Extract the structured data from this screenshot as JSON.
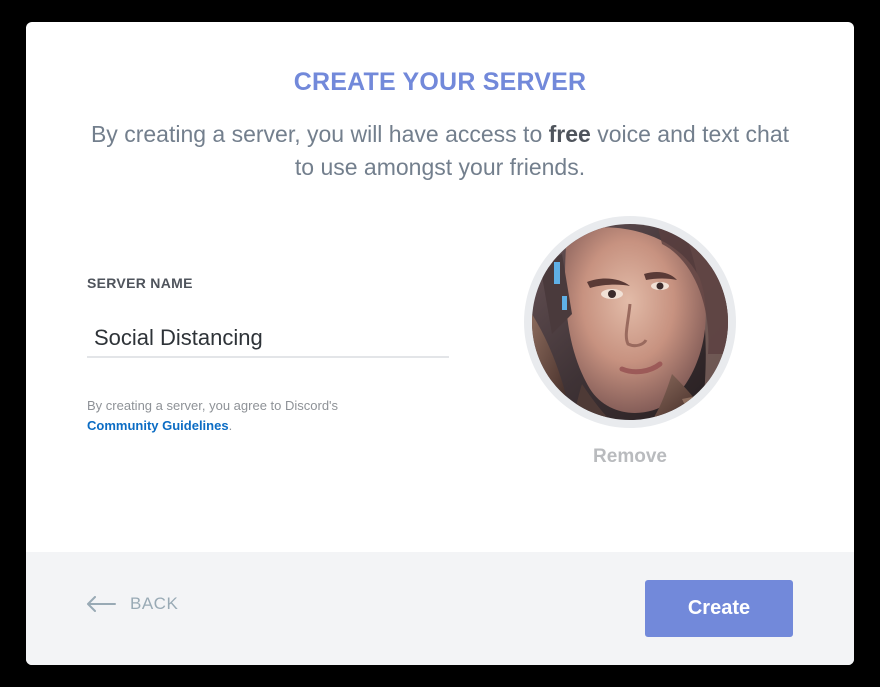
{
  "modal": {
    "title": "CREATE YOUR SERVER",
    "subtitle_before": "By creating a server, you will have access to ",
    "subtitle_bold": "free",
    "subtitle_after": " voice and text chat to use amongst your friends."
  },
  "server_name": {
    "label": "SERVER NAME",
    "value": "Social Distancing"
  },
  "agreement": {
    "text": "By creating a server, you agree to Discord's",
    "link_label": "Community Guidelines",
    "end": "."
  },
  "avatar": {
    "remove_label": "Remove"
  },
  "footer": {
    "back_label": "BACK",
    "create_label": "Create"
  },
  "colors": {
    "accent": "#7289da",
    "link": "#0b6cc4",
    "backdrop": "#000000",
    "footer_bg": "#f3f4f6"
  },
  "icons": {
    "back": "arrow-left-icon"
  }
}
